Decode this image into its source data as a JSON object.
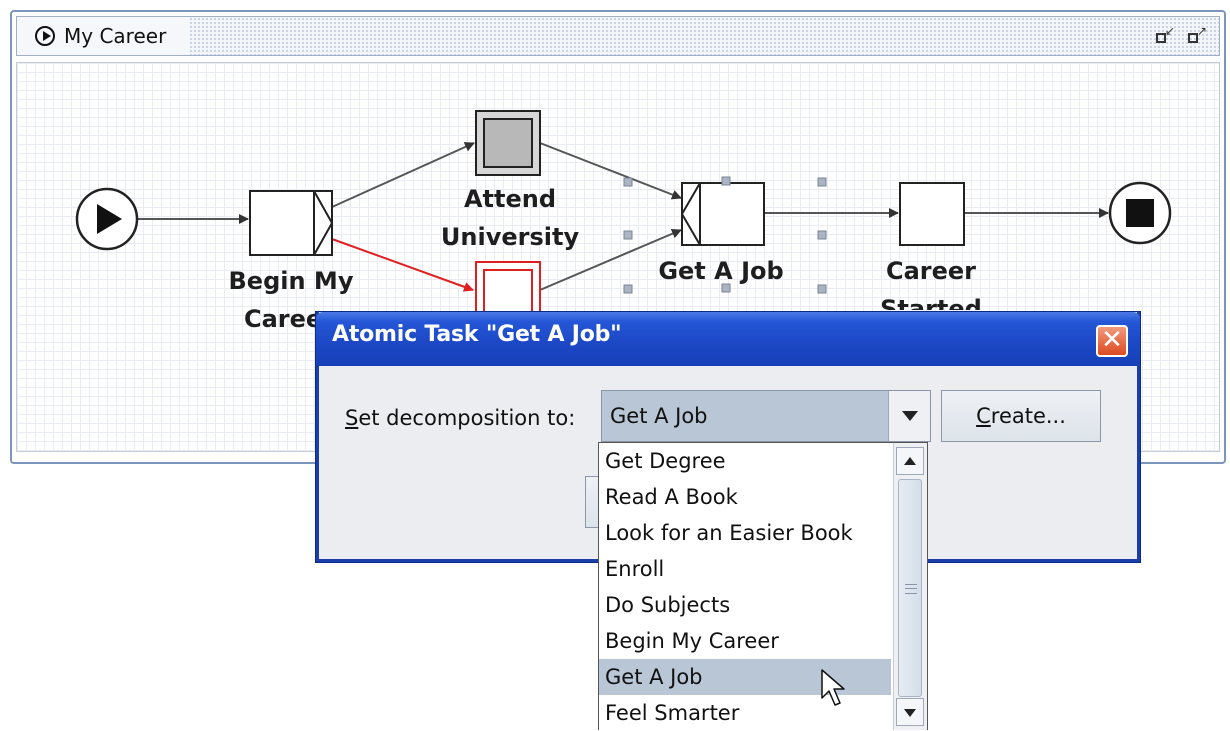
{
  "net_window": {
    "title": "My Career"
  },
  "nodes": {
    "begin_my_career": {
      "label_line1": "Begin My",
      "label_line2": "Caree"
    },
    "attend_university": {
      "label_line1": "Attend",
      "label_line2": "University"
    },
    "get_a_job": {
      "label": "Get A Job"
    },
    "career_started": {
      "label_line1": "Career",
      "label_line2": "Started"
    }
  },
  "dialog": {
    "title": "Atomic Task \"Get A Job\"",
    "decomposition_label_mnemonic": "S",
    "decomposition_label_rest": "et decomposition to:",
    "selected_value": "Get A Job",
    "create_button_mnemonic": "C",
    "create_button_rest": "reate..."
  },
  "dropdown": {
    "items": [
      "Get Degree",
      "Read A Book",
      "Look for an Easier Book",
      "Enroll",
      "Do Subjects",
      "Begin My Career",
      "Get A Job",
      "Feel Smarter"
    ],
    "selected_index": 6
  },
  "colors": {
    "selected_row": "#b8c6d6",
    "dialog_title_bar": "#1c47c5",
    "highlight_edge": "#e02020"
  }
}
